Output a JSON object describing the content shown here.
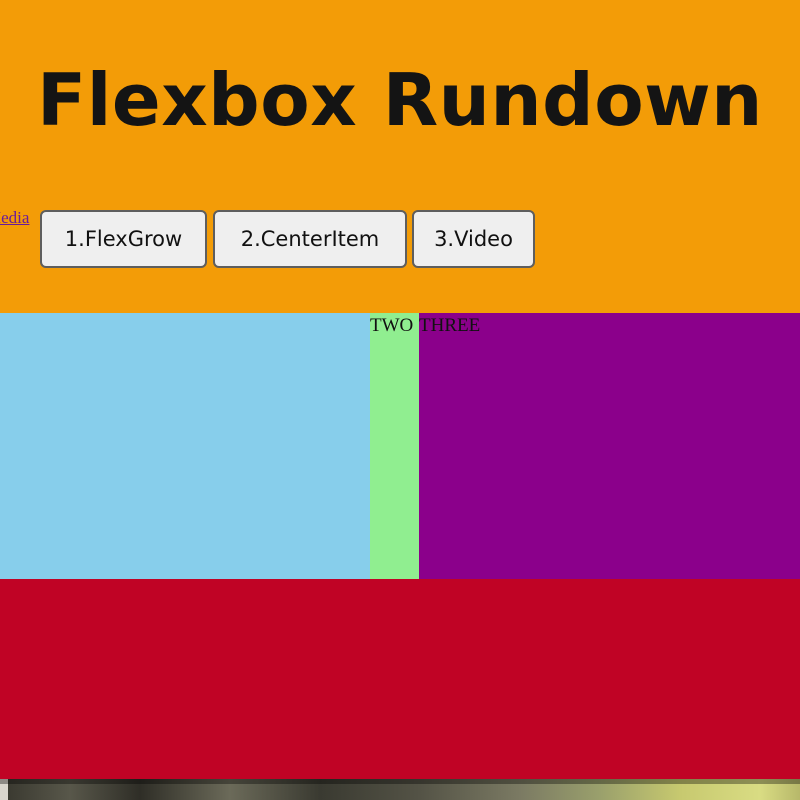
{
  "header": {
    "title": "Flexbox Rundown",
    "nav_link": "Media",
    "buttons": [
      {
        "label": "1.FlexGrow"
      },
      {
        "label": "2.CenterItem"
      },
      {
        "label": "3.Video"
      }
    ],
    "background_color": "#f39c07"
  },
  "flex_demo": {
    "boxes": [
      {
        "label": "",
        "color": "#87ceeb"
      },
      {
        "label": "TWO",
        "color": "#90ee90"
      },
      {
        "label": "THREE",
        "color": "#8b008b"
      }
    ]
  },
  "footer_band": {
    "color": "#c00325"
  }
}
